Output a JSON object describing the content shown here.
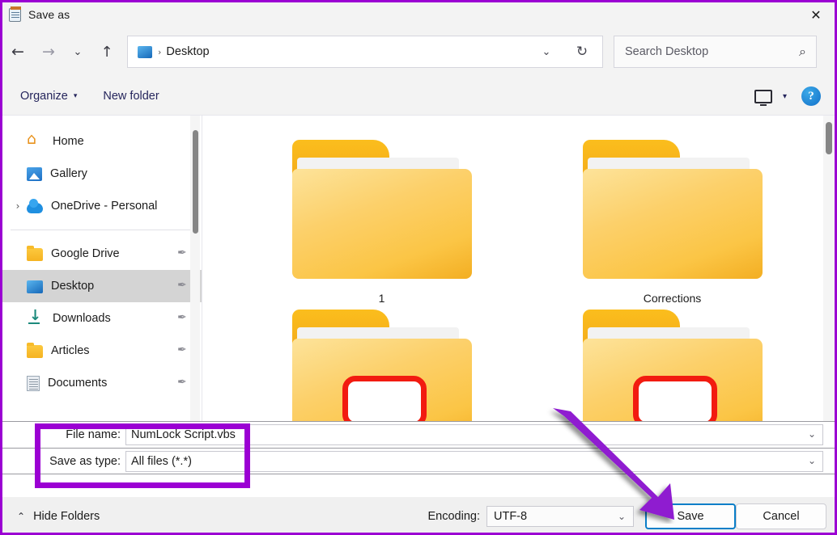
{
  "window": {
    "title": "Save as",
    "title_icon": "notepad-icon",
    "close_label": "✕",
    "border_color": "#9b00d3"
  },
  "nav": {
    "back": "←",
    "forward": "→",
    "recent": "⌄",
    "up": "↑",
    "address": {
      "icon": "desktop-icon",
      "separator": "›",
      "crumb": "Desktop",
      "dropdown": "⌄",
      "refresh": "↻"
    },
    "search": {
      "placeholder": "Search Desktop",
      "icon": "⌕"
    }
  },
  "commandbar": {
    "organize": "Organize",
    "organize_caret": "▾",
    "new_folder": "New folder",
    "view_caret": "▾",
    "help": "?"
  },
  "sidebar": {
    "items": [
      {
        "label": "Home",
        "icon": "home-icon",
        "expander": "",
        "pinned": false,
        "selected": false
      },
      {
        "label": "Gallery",
        "icon": "gallery-icon",
        "expander": "",
        "pinned": false,
        "selected": false
      },
      {
        "label": "OneDrive - Personal",
        "icon": "cloud-icon",
        "expander": "›",
        "pinned": false,
        "selected": false
      },
      {
        "label": "Google Drive",
        "icon": "folder-icon",
        "expander": "",
        "pinned": true,
        "selected": false
      },
      {
        "label": "Desktop",
        "icon": "desktop-icon",
        "expander": "",
        "pinned": true,
        "selected": true
      },
      {
        "label": "Downloads",
        "icon": "download-icon",
        "expander": "",
        "pinned": true,
        "selected": false
      },
      {
        "label": "Articles",
        "icon": "folder-icon",
        "expander": "",
        "pinned": true,
        "selected": false
      },
      {
        "label": "Documents",
        "icon": "document-icon",
        "expander": "",
        "pinned": true,
        "selected": false
      }
    ],
    "pin_glyph": "✒"
  },
  "filelist": {
    "items": [
      {
        "name": "1",
        "type": "folder",
        "marked": false
      },
      {
        "name": "Corrections",
        "type": "folder",
        "marked": false
      },
      {
        "name": "",
        "type": "folder",
        "marked": true
      },
      {
        "name": "",
        "type": "folder",
        "marked": true
      }
    ]
  },
  "form": {
    "filename_label": "File name:",
    "filename_value": "NumLock Script.vbs",
    "filetype_label": "Save as type:",
    "filetype_value": "All files  (*.*)",
    "chevron": "⌄"
  },
  "footer": {
    "hide_folders": "Hide Folders",
    "hide_folders_caret": "⌃",
    "encoding_label": "Encoding:",
    "encoding_value": "UTF-8",
    "encoding_chevron": "⌄",
    "save": "Save",
    "cancel": "Cancel"
  },
  "annotations": {
    "highlight_color": "#9b00d3",
    "arrow_color": "#8f1fd0",
    "arrow_target": "Save"
  }
}
